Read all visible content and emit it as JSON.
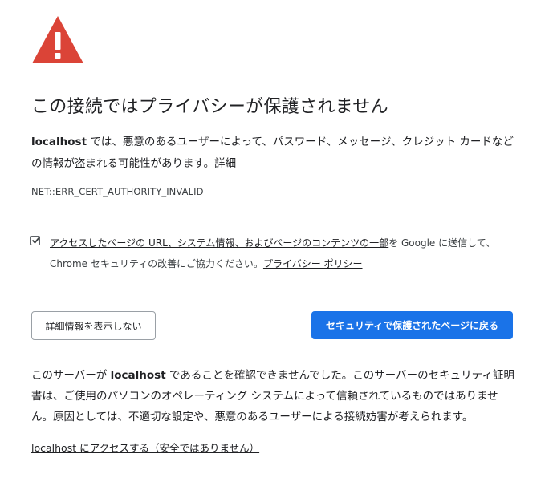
{
  "icon": {
    "name": "warning-triangle-icon",
    "color": "#db4437",
    "mark_color": "#ffffff"
  },
  "title": "この接続ではプライバシーが保護されません",
  "description": {
    "host": "localhost",
    "text": " では、悪意のあるユーザーによって、パスワード、メッセージ、クレジット カードなどの情報が盗まれる可能性があります。",
    "details_link": "詳細"
  },
  "error_code": "NET::ERR_CERT_AUTHORITY_INVALID",
  "optin": {
    "checked": true,
    "link_text": "アクセスしたページの URL、システム情報、およびページのコンテンツの一部",
    "text": "を Google に送信して、Chrome セキュリティの改善にご協力ください。",
    "privacy_link": "プライバシー ポリシー"
  },
  "buttons": {
    "details_label": "詳細情報を表示しない",
    "back_label": "セキュリティで保護されたページに戻る",
    "primary_color": "#1a73e8"
  },
  "explanation": {
    "prefix": "このサーバーが ",
    "host": "localhost",
    "text": " であることを確認できませんでした。このサーバーのセキュリティ証明書は、ご使用のパソコンのオペレーティング システムによって信頼されているものではありません。原因としては、不適切な設定や、悪意のあるユーザーによる接続妨害が考えられます。"
  },
  "proceed_link": "localhost にアクセスする（安全ではありません）"
}
